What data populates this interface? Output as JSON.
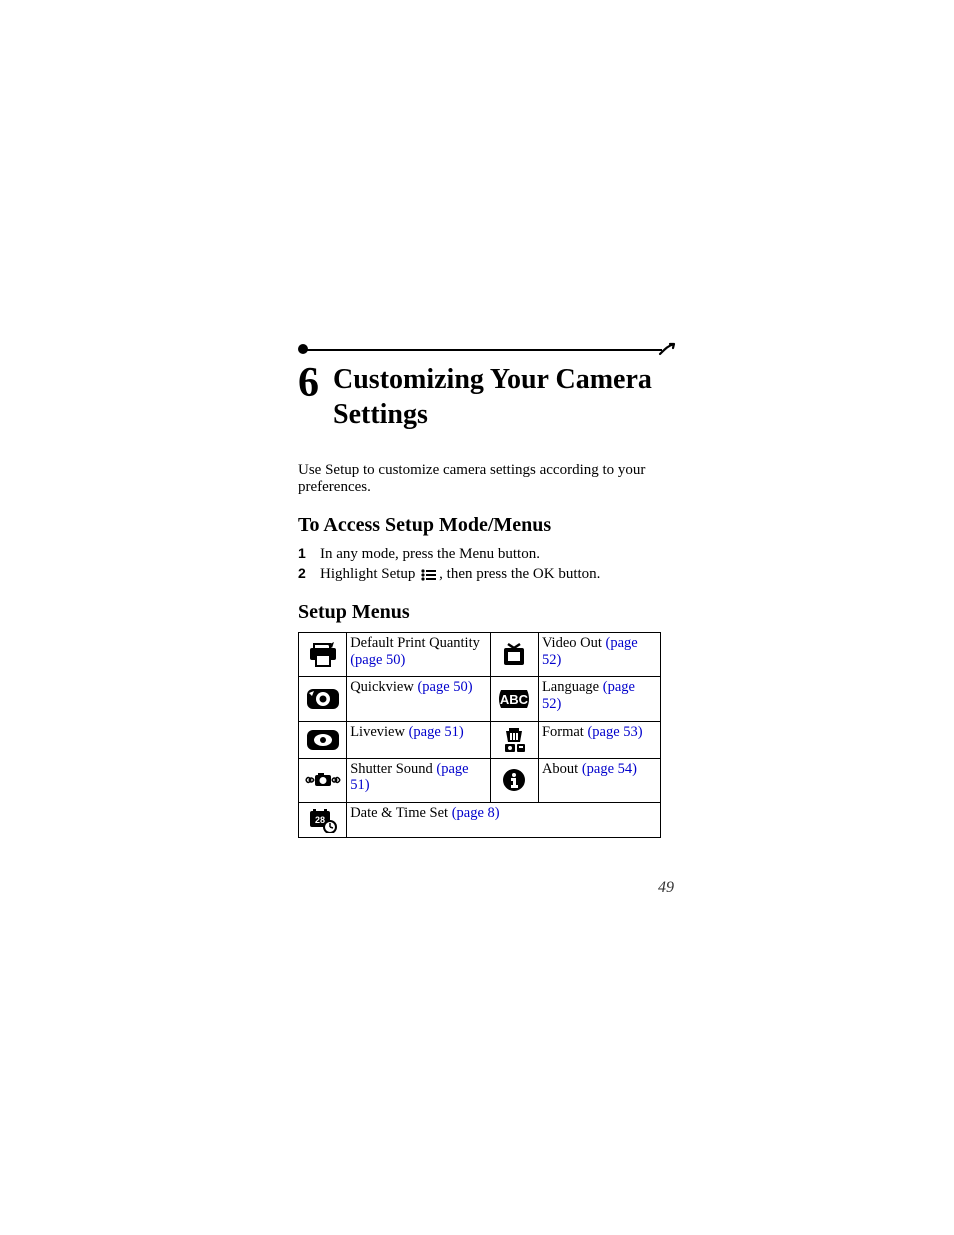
{
  "chapter": {
    "number": "6",
    "title": "Customizing Your Camera Settings"
  },
  "intro": "Use Setup to customize camera settings according to your preferences.",
  "h2_access": "To Access Setup Mode/Menus",
  "steps": {
    "s1_num": "1",
    "s1_text": "In any mode, press the Menu button.",
    "s2_num": "2",
    "s2_pre": "Highlight Setup ",
    "s2_post": ", then press the OK button."
  },
  "h2_menus": "Setup Menus",
  "table": {
    "r1l_label": "Default Print Quantity ",
    "r1l_link": "(page 50)",
    "r1r_label": "Video Out ",
    "r1r_link": "(page 52)",
    "r2l_label": "Quickview ",
    "r2l_link": "(page 50)",
    "r2r_label": "Language ",
    "r2r_link": "(page 52)",
    "r3l_label": "Liveview ",
    "r3l_link": "(page 51)",
    "r3r_label": "Format ",
    "r3r_link": "(page 53)",
    "r4l_label": "Shutter Sound ",
    "r4l_link": "(page 51)",
    "r4r_label": "About ",
    "r4r_link": "(page 54)",
    "r5l_label": "Date & Time Set ",
    "r5l_link": "(page 8)"
  },
  "page_number": "49"
}
